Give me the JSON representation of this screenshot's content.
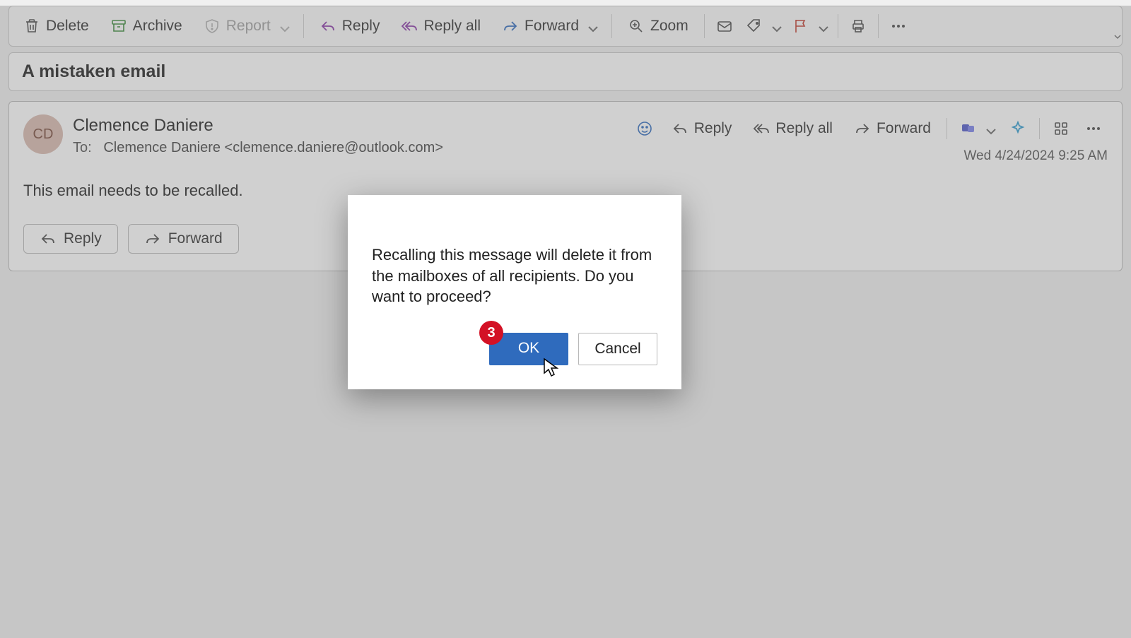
{
  "ribbon": {
    "delete": "Delete",
    "archive": "Archive",
    "report": "Report",
    "reply": "Reply",
    "reply_all": "Reply all",
    "forward": "Forward",
    "zoom": "Zoom"
  },
  "subject": "A mistaken email",
  "message": {
    "avatar_initials": "CD",
    "from_name": "Clemence Daniere",
    "to_label": "To:",
    "to_value": "Clemence Daniere <clemence.daniere@outlook.com>",
    "actions": {
      "reply": "Reply",
      "reply_all": "Reply all",
      "forward": "Forward"
    },
    "date": "Wed 4/24/2024 9:25 AM",
    "body": "This email needs to be recalled.",
    "footer": {
      "reply": "Reply",
      "forward": "Forward"
    }
  },
  "dialog": {
    "text": "Recalling this message will delete it from the mailboxes of all recipients. Do you want to proceed?",
    "ok": "OK",
    "cancel": "Cancel"
  },
  "badge": "3"
}
